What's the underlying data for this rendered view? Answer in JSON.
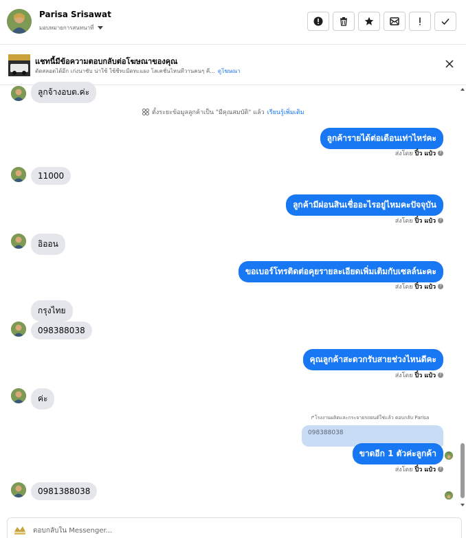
{
  "header": {
    "name": "Parisa Srisawat",
    "assign_label": "มอบหมายการสนทนาที่"
  },
  "banner": {
    "title": "แชทนี้มีข้อความตอบกลับต่อโฆษณาของคุณ",
    "subtitle": "ตัดสลอตได้อีก เก่งนาชับ น่าใช้ ใช้ชีทะมีดทะแผง โลเคชั่นไหนทีวานคนๆ คี...",
    "link": "ดูโฆษณา"
  },
  "system_note": {
    "text": "ตั้งระยะข้อมูลลูกค้าเป็น \"มีคุณสมบัติ\" แล้ว",
    "link": "เรียนรู้เพิ่มเติม"
  },
  "messages": {
    "m0": "ลูกจ้างอบต.ค่ะ",
    "m1": "ลูกค้ารายได้ต่อเดือนเท่าไหร่คะ",
    "m2": "11000",
    "m3": "ลูกค้ามีผ่อนสินเชื่ออะไรอยู่ไหมคะปัจจุบัน",
    "m4": "อิออน",
    "m5": "ขอเบอร์โทรติดต่อคุยรายละเอียดเพิ่มเติมกับเซลล์นะคะ",
    "m6": "กรุงไทย",
    "m7": "098388038",
    "m8": "คุณลูกค้าสะดวกรับสายช่วงไหนดีคะ",
    "m9": "ค่ะ",
    "m10": "ขาดอีก 1 ตัวค่ะลูกค้า",
    "m11": "0981388038"
  },
  "sent_by": {
    "prefix": "ส่งโดย",
    "name": "ปิ๋ว แป๋ว"
  },
  "reply": {
    "context": "โรงงานผลิตและกระจายรถยนต์ใช่แล้ว ตอบกลับ Parisa",
    "quoted": "098388038"
  },
  "composer": {
    "placeholder": "ตอบกลับใน Messenger..."
  },
  "colors": {
    "outgoing": "#1877f2",
    "incoming": "#e4e6eb",
    "quoted": "#c9dcf5"
  }
}
